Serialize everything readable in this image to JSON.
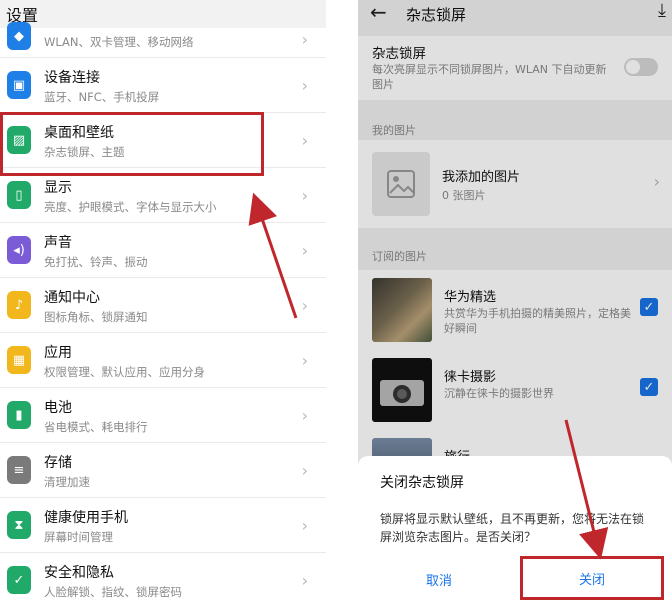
{
  "left": {
    "title": "设置",
    "items": [
      {
        "title": "",
        "sub": "WLAN、双卡管理、移动网络",
        "icon": "network-icon",
        "color": "#1e7fe6"
      },
      {
        "title": "设备连接",
        "sub": "蓝牙、NFC、手机投屏",
        "icon": "device-connect-icon",
        "color": "#1e7fe6"
      },
      {
        "title": "桌面和壁纸",
        "sub": "杂志锁屏、主题",
        "icon": "wallpaper-icon",
        "color": "#21a96a"
      },
      {
        "title": "显示",
        "sub": "亮度、护眼模式、字体与显示大小",
        "icon": "display-icon",
        "color": "#21a96a"
      },
      {
        "title": "声音",
        "sub": "免打扰、铃声、振动",
        "icon": "sound-icon",
        "color": "#7b5cd6"
      },
      {
        "title": "通知中心",
        "sub": "图标角标、锁屏通知",
        "icon": "notification-icon",
        "color": "#f2b71d"
      },
      {
        "title": "应用",
        "sub": "权限管理、默认应用、应用分身",
        "icon": "apps-icon",
        "color": "#f2b71d"
      },
      {
        "title": "电池",
        "sub": "省电模式、耗电排行",
        "icon": "battery-icon",
        "color": "#21a96a"
      },
      {
        "title": "存储",
        "sub": "清理加速",
        "icon": "storage-icon",
        "color": "#7a7a7a"
      },
      {
        "title": "健康使用手机",
        "sub": "屏幕时间管理",
        "icon": "hourglass-icon",
        "color": "#21a96a"
      },
      {
        "title": "安全和隐私",
        "sub": "人脸解锁、指纹、锁屏密码",
        "icon": "shield-icon",
        "color": "#21a96a"
      }
    ]
  },
  "right": {
    "title": "杂志锁屏",
    "toggle": {
      "label": "杂志锁屏",
      "desc": "每次亮屏显示不同锁屏图片，WLAN 下自动更新图片"
    },
    "my_section_label": "我的图片",
    "my_images": {
      "title": "我添加的图片",
      "count": "0 张图片"
    },
    "subs_section_label": "订阅的图片",
    "subscriptions": [
      {
        "title": "华为精选",
        "desc": "共赏华为手机拍摄的精美照片，定格美好瞬间"
      },
      {
        "title": "徕卡摄影",
        "desc": "沉静在徕卡的摄影世界"
      },
      {
        "title": "旅行",
        "desc": ""
      }
    ],
    "dialog": {
      "title": "关闭杂志锁屏",
      "body": "锁屏将显示默认壁纸，且不再更新，您将无法在锁屏浏览杂志图片。是否关闭？",
      "cancel": "取消",
      "confirm": "关闭"
    }
  },
  "colors": {
    "accent": "#1a73e8",
    "annotation": "#c0272d"
  }
}
